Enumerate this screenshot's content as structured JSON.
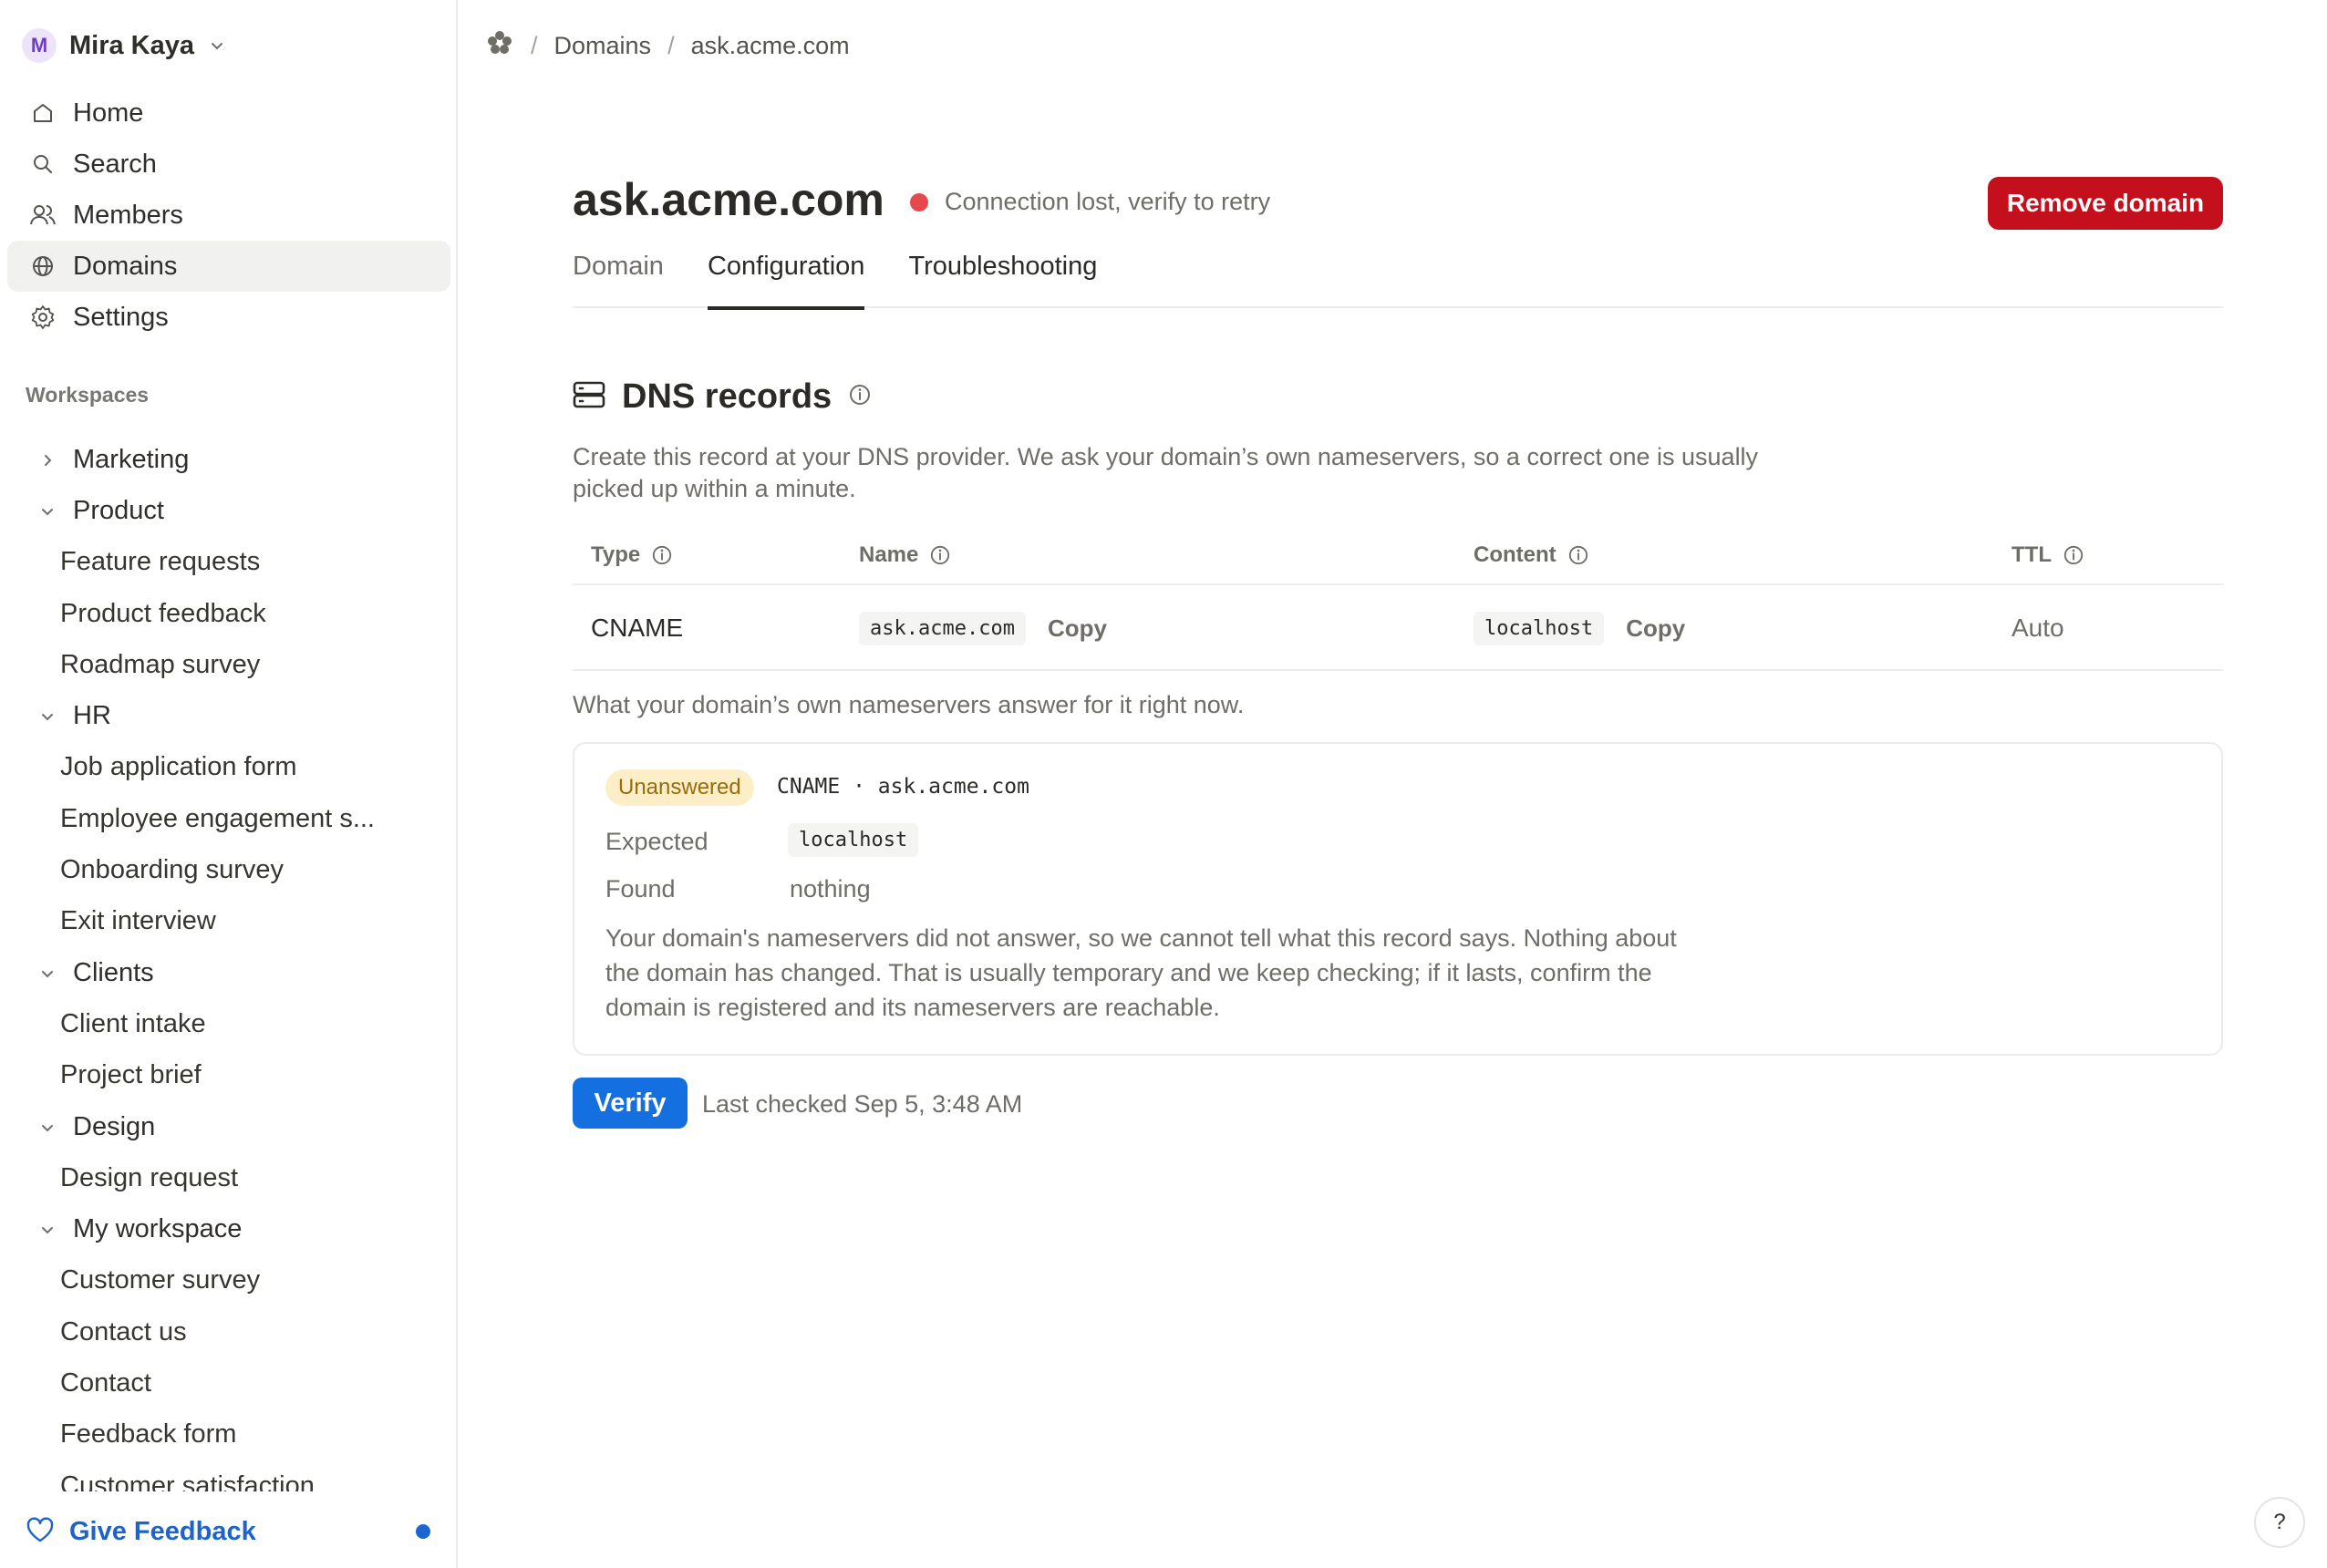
{
  "sidebar": {
    "user": {
      "initial": "M",
      "name": "Mira Kaya"
    },
    "nav": [
      {
        "label": "Home",
        "icon": "home-icon"
      },
      {
        "label": "Search",
        "icon": "search-icon"
      },
      {
        "label": "Members",
        "icon": "members-icon"
      },
      {
        "label": "Domains",
        "icon": "globe-icon",
        "active": true
      },
      {
        "label": "Settings",
        "icon": "gear-icon"
      }
    ],
    "workspaces_label": "Workspaces",
    "tree": {
      "marketing": "Marketing",
      "product": "Product",
      "product_items": [
        "Feature requests",
        "Product feedback",
        "Roadmap survey"
      ],
      "hr": "HR",
      "hr_items": [
        "Job application form",
        "Employee engagement s...",
        "Onboarding survey",
        "Exit interview"
      ],
      "clients": "Clients",
      "clients_items": [
        "Client intake",
        "Project brief"
      ],
      "design": "Design",
      "design_items": [
        "Design request"
      ],
      "my_workspace": "My workspace",
      "my_workspace_items": [
        "Customer survey",
        "Contact us",
        "Contact",
        "Feedback form",
        "Customer satisfaction"
      ]
    },
    "feedback_label": "Give Feedback"
  },
  "breadcrumb": {
    "root_icon": "logo-icon",
    "items": [
      "Domains",
      "ask.acme.com"
    ],
    "separator": "/"
  },
  "header": {
    "title": "ask.acme.com",
    "status": "Connection lost, verify to retry",
    "status_color": "#e5484d",
    "remove_label": "Remove domain"
  },
  "tabs": [
    "Domain",
    "Configuration",
    "Troubleshooting"
  ],
  "active_tab": "Configuration",
  "dns": {
    "title": "DNS records",
    "description": "Create this record at your DNS provider. We ask your domain’s own nameservers, so a correct one is usually picked up within a minute.",
    "columns": [
      "Type",
      "Name",
      "Content",
      "TTL"
    ],
    "record": {
      "type": "CNAME",
      "name": "ask.acme.com",
      "content": "localhost",
      "ttl": "Auto",
      "copy_label": "Copy"
    }
  },
  "answer": {
    "label": "What your domain’s own nameservers answer for it right now.",
    "badge": "Unanswered",
    "record": "CNAME · ask.acme.com",
    "expected_label": "Expected",
    "expected_value": "localhost",
    "found_label": "Found",
    "found_value": "nothing",
    "explanation": "Your domain's nameservers did not answer, so we cannot tell what this record says. Nothing about the domain has changed. That is usually temporary and we keep checking; if it lasts, confirm the domain is registered and its nameservers are reachable."
  },
  "verify_label": "Verify",
  "last_checked": "Last checked Sep 5, 3:48 AM",
  "help_label": "?",
  "colors": {
    "accent": "#1470e0",
    "danger": "#c4101c",
    "badge_bg": "#fcefc7"
  }
}
